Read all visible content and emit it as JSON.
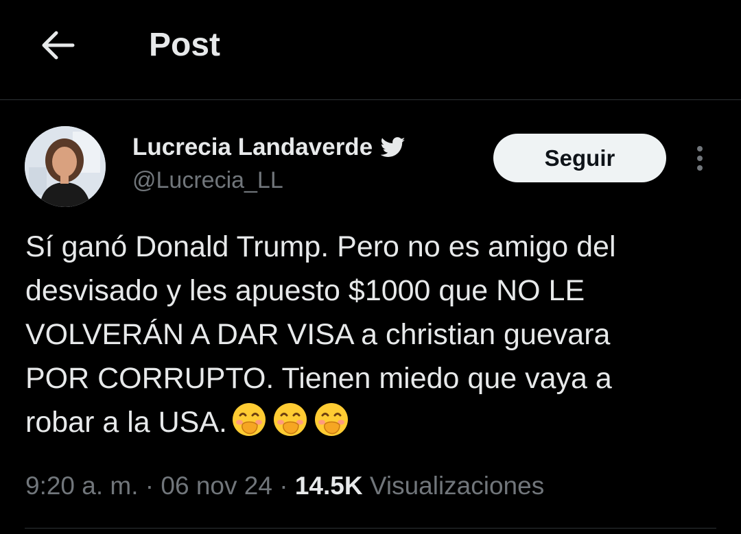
{
  "header": {
    "title": "Post",
    "back_icon": "arrow-left-icon"
  },
  "author": {
    "display_name": "Lucrecia Landaverde",
    "handle": "@Lucrecia_LL",
    "verified_icon": "twitter-bird-icon"
  },
  "actions": {
    "follow_label": "Seguir",
    "more_icon": "more-vertical-icon"
  },
  "tweet": {
    "text": "Sí ganó Donald Trump. Pero no es amigo del\ndesvisado y les apuesto $1000 que NO LE\nVOLVERÁN A DAR VISA a christian guevara\nPOR CORRUPTO. Tienen miedo que vaya a\nrobar a la USA.",
    "emojis": [
      "face-with-hand-over-mouth-emoji",
      "face-with-hand-over-mouth-emoji",
      "face-with-hand-over-mouth-emoji"
    ]
  },
  "meta": {
    "time": "9:20 a. m.",
    "separator": " · ",
    "date": "06 nov 24",
    "views_count": "14.5K",
    "views_label": "Visualizaciones"
  },
  "colors": {
    "background": "#000000",
    "text_primary": "#e7e9ea",
    "text_secondary": "#71767b",
    "divider": "#2f3336",
    "follow_bg": "#eff3f4",
    "follow_text": "#0f1419"
  }
}
